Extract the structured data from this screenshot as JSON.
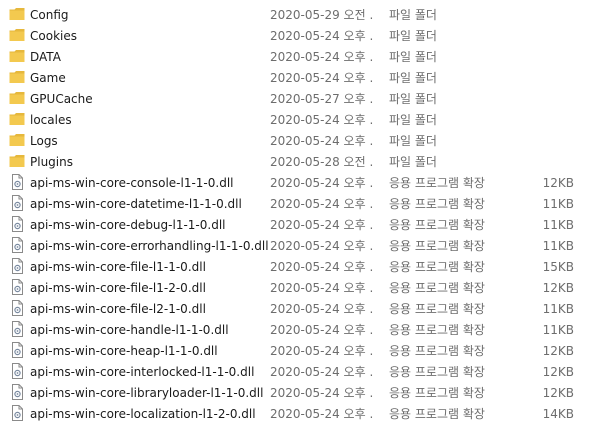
{
  "items": [
    {
      "name": "Config",
      "date": "2020-05-29 오전 ...",
      "type": "파일 폴더",
      "size": "",
      "icon": "folder-icon"
    },
    {
      "name": "Cookies",
      "date": "2020-05-24 오후 ...",
      "type": "파일 폴더",
      "size": "",
      "icon": "folder-icon"
    },
    {
      "name": "DATA",
      "date": "2020-05-24 오후 ...",
      "type": "파일 폴더",
      "size": "",
      "icon": "folder-icon"
    },
    {
      "name": "Game",
      "date": "2020-05-24 오후 ...",
      "type": "파일 폴더",
      "size": "",
      "icon": "folder-icon"
    },
    {
      "name": "GPUCache",
      "date": "2020-05-27 오후 ...",
      "type": "파일 폴더",
      "size": "",
      "icon": "folder-icon"
    },
    {
      "name": "locales",
      "date": "2020-05-24 오후 ...",
      "type": "파일 폴더",
      "size": "",
      "icon": "folder-icon"
    },
    {
      "name": "Logs",
      "date": "2020-05-24 오후 ...",
      "type": "파일 폴더",
      "size": "",
      "icon": "folder-icon"
    },
    {
      "name": "Plugins",
      "date": "2020-05-28 오전 ...",
      "type": "파일 폴더",
      "size": "",
      "icon": "folder-icon"
    },
    {
      "name": "api-ms-win-core-console-l1-1-0.dll",
      "date": "2020-05-24 오후 ...",
      "type": "응용 프로그램 확장",
      "size": "12KB",
      "icon": "dll-file-icon"
    },
    {
      "name": "api-ms-win-core-datetime-l1-1-0.dll",
      "date": "2020-05-24 오후 ...",
      "type": "응용 프로그램 확장",
      "size": "11KB",
      "icon": "dll-file-icon"
    },
    {
      "name": "api-ms-win-core-debug-l1-1-0.dll",
      "date": "2020-05-24 오후 ...",
      "type": "응용 프로그램 확장",
      "size": "11KB",
      "icon": "dll-file-icon"
    },
    {
      "name": "api-ms-win-core-errorhandling-l1-1-0.dll",
      "date": "2020-05-24 오후 ...",
      "type": "응용 프로그램 확장",
      "size": "11KB",
      "icon": "dll-file-icon"
    },
    {
      "name": "api-ms-win-core-file-l1-1-0.dll",
      "date": "2020-05-24 오후 ...",
      "type": "응용 프로그램 확장",
      "size": "15KB",
      "icon": "dll-file-icon"
    },
    {
      "name": "api-ms-win-core-file-l1-2-0.dll",
      "date": "2020-05-24 오후 ...",
      "type": "응용 프로그램 확장",
      "size": "12KB",
      "icon": "dll-file-icon"
    },
    {
      "name": "api-ms-win-core-file-l2-1-0.dll",
      "date": "2020-05-24 오후 ...",
      "type": "응용 프로그램 확장",
      "size": "11KB",
      "icon": "dll-file-icon"
    },
    {
      "name": "api-ms-win-core-handle-l1-1-0.dll",
      "date": "2020-05-24 오후 ...",
      "type": "응용 프로그램 확장",
      "size": "11KB",
      "icon": "dll-file-icon"
    },
    {
      "name": "api-ms-win-core-heap-l1-1-0.dll",
      "date": "2020-05-24 오후 ...",
      "type": "응용 프로그램 확장",
      "size": "12KB",
      "icon": "dll-file-icon"
    },
    {
      "name": "api-ms-win-core-interlocked-l1-1-0.dll",
      "date": "2020-05-24 오후 ...",
      "type": "응용 프로그램 확장",
      "size": "12KB",
      "icon": "dll-file-icon"
    },
    {
      "name": "api-ms-win-core-libraryloader-l1-1-0.dll",
      "date": "2020-05-24 오후 ...",
      "type": "응용 프로그램 확장",
      "size": "12KB",
      "icon": "dll-file-icon"
    },
    {
      "name": "api-ms-win-core-localization-l1-2-0.dll",
      "date": "2020-05-24 오후 ...",
      "type": "응용 프로그램 확장",
      "size": "14KB",
      "icon": "dll-file-icon"
    }
  ],
  "colors": {
    "folder": "#f3c94f",
    "folder_tab": "#e6b83c",
    "text": "#1a1a1a",
    "muted": "#6d6d6d"
  }
}
